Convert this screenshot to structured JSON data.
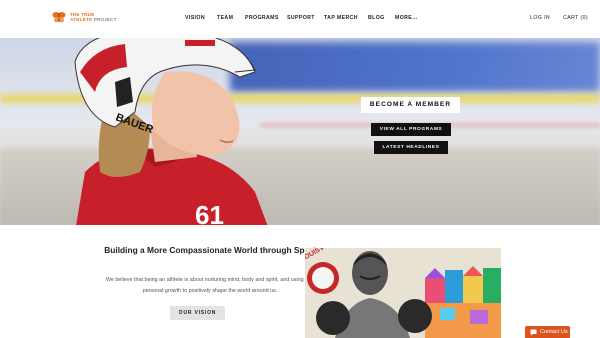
{
  "logo": {
    "line1": "THE TRUE",
    "line2a": "ATHLETE",
    "line2b": "PROJECT"
  },
  "nav": [
    {
      "label": "VISION"
    },
    {
      "label": "TEAM"
    },
    {
      "label": "PROGRAMS"
    },
    {
      "label": "SUPPORT"
    },
    {
      "label": "TAP MERCH"
    },
    {
      "label": "BLOG"
    },
    {
      "label": "MORE..."
    }
  ],
  "nav_right": {
    "login": "LOG IN",
    "cart": "CART (0)"
  },
  "hero": {
    "helmet_brand": "BAUER",
    "jersey_number": "61",
    "member_button": "BECOME A MEMBER",
    "programs_button": "VIEW ALL PROGRAMS",
    "headlines_button": "LATEST HEADLINES"
  },
  "section": {
    "title": "Building a More Compassionate World through Sport",
    "body": "We believe that being an athlete is about nurturing mind, body and spirit, and using that personal growth to positively shape the world around us.",
    "vision_button": "OUR VISION",
    "mural_text": "LOUISVILLE"
  },
  "contact": {
    "label": "Contact Us"
  },
  "colors": {
    "brand_orange": "#e8701a",
    "contact_orange": "#d9541f",
    "jersey_red": "#c8202a"
  },
  "icons": {
    "logo": "butterfly-icon",
    "contact": "chat-bubble-icon"
  }
}
